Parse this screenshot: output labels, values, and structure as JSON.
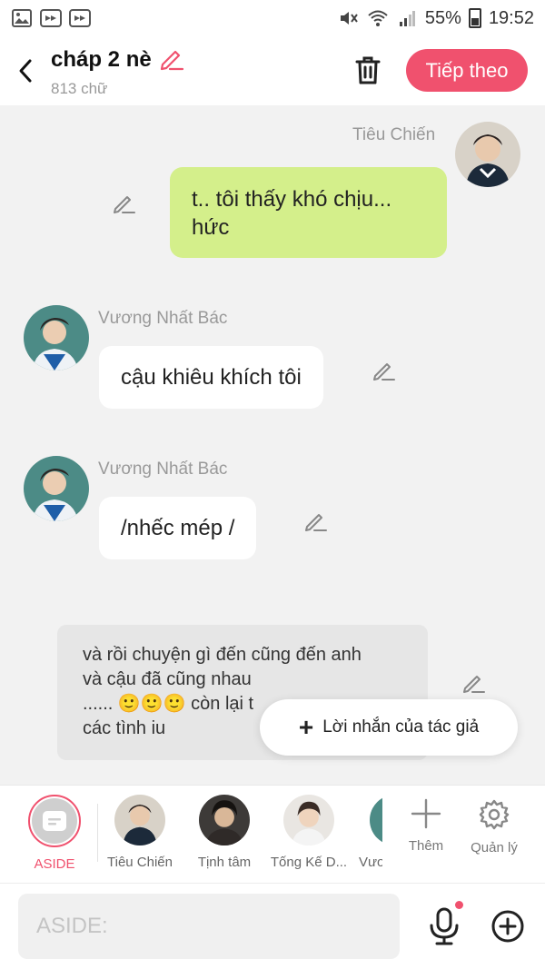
{
  "status_bar": {
    "battery": "55%",
    "time": "19:52"
  },
  "header": {
    "title": "cháp 2 nè",
    "word_count": "813 chữ",
    "next_label": "Tiếp theo"
  },
  "messages": [
    {
      "speaker": "Tiêu Chiến",
      "side": "right",
      "text_lines": [
        "t.. tôi thấy khó chịu...",
        "hức"
      ]
    },
    {
      "speaker": "Vương Nhất Bác",
      "side": "left",
      "text": "cậu khiêu khích tôi"
    },
    {
      "speaker": "Vương Nhất Bác",
      "side": "left",
      "text": "/nhếc mép /"
    },
    {
      "speaker": "ASIDE",
      "side": "center",
      "text_lines": [
        "và rồi chuyện gì đến cũng đến anh",
        "và cậu đã cũng nhau",
        "...... 🙂🙂🙂 còn lại t",
        "các tình iu"
      ]
    }
  ],
  "author_note_label": "Lời nhắn của tác giả",
  "characters": [
    {
      "label": "ASIDE",
      "active": true
    },
    {
      "label": "Tiêu Chiến"
    },
    {
      "label": "Tịnh tâm"
    },
    {
      "label": "Tống Kế D..."
    },
    {
      "label": "Vươ"
    }
  ],
  "tools": {
    "more_label": "Thêm",
    "manage_label": "Quản lý"
  },
  "input": {
    "placeholder": "ASIDE:"
  },
  "colors": {
    "accent": "#f0516e",
    "bubble_right": "#d4ef8b",
    "bubble_left": "#ffffff",
    "bubble_aside": "#e6e6e6"
  }
}
